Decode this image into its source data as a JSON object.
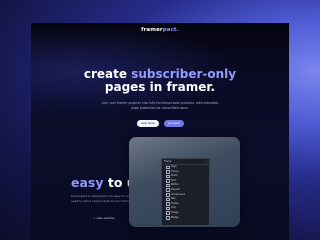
{
  "brand": {
    "prefix": "framer",
    "accent": "pact."
  },
  "hero": {
    "line1_plain": "create ",
    "line1_accent": "subscriber-only",
    "line2": "pages in framer.",
    "subtitle": "turn your framer projects into fully functional saas products, with extended page protection for subscribed users.",
    "primary_button": "view demo",
    "secondary_button": "purchase"
  },
  "feature": {
    "title_accent": "easy",
    "title_rest": " to use.",
    "description": "framerpact is designed to be easy to use, you only need to add 2 components to your framer project.",
    "link_arrow": "→",
    "link_label": "view readme"
  },
  "mockup": {
    "header_left": "Frame",
    "header_sep": "/",
    "rows": [
      "Page",
      "Frame",
      "Stack",
      "Text",
      "Button",
      "Paywall",
      "Component",
      "Nav",
      "Footer",
      "Link",
      "Image",
      "Badge"
    ]
  },
  "colors": {
    "accent": "#8f98ff",
    "background": "#0b0d2a",
    "primary_button": "#f2f3fb",
    "secondary_button": "#6f7ae8"
  }
}
